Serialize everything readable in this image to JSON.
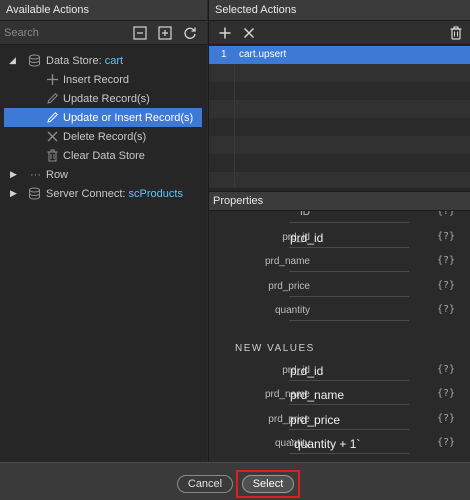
{
  "left_panel": {
    "title": "Available Actions",
    "search_placeholder": "Search",
    "tools": [
      "collapse-all-icon",
      "expand-all-icon",
      "refresh-icon"
    ],
    "tree": [
      {
        "prefix": "Data Store: ",
        "highlight": "cart",
        "icon": "database-icon",
        "expanded": true
      },
      {
        "label": "Insert Record",
        "icon": "plus-icon"
      },
      {
        "label": "Update Record(s)",
        "icon": "pencil-icon"
      },
      {
        "label": "Update or Insert Record(s)",
        "icon": "pencil-icon",
        "selected": true
      },
      {
        "label": "Delete Record(s)",
        "icon": "x-icon"
      },
      {
        "label": "Clear Data Store",
        "icon": "trash-icon"
      },
      {
        "label": "Row",
        "icon": "ellipsis-icon",
        "expanded": false
      },
      {
        "prefix": "Server Connect: ",
        "highlight": "scProducts",
        "icon": "database-icon",
        "expanded": false
      }
    ]
  },
  "right_panel": {
    "title": "Selected Actions",
    "tools": [
      "add-icon",
      "remove-icon",
      "trash-icon"
    ],
    "actions": [
      {
        "num": "1",
        "name": "cart.upsert"
      }
    ]
  },
  "properties": {
    "title": "Properties",
    "filter_rows": [
      {
        "label": "ID",
        "value": ""
      },
      {
        "label": "prd_id",
        "value": "prd_id"
      },
      {
        "label": "prd_name",
        "value": ""
      },
      {
        "label": "prd_price",
        "value": ""
      },
      {
        "label": "quantity",
        "value": ""
      }
    ],
    "section_title": "NEW VALUES",
    "value_rows": [
      {
        "label": "prd_id",
        "value": "prd_id"
      },
      {
        "label": "prd_name",
        "value": "prd_name"
      },
      {
        "label": "prd_price",
        "value": "prd_price"
      },
      {
        "label": "quantity",
        "value": "`quantity + 1`"
      }
    ],
    "fx_label": "{?}"
  },
  "footer": {
    "cancel_label": "Cancel",
    "select_label": "Select"
  },
  "colors": {
    "accent": "#3d7ad6",
    "highlight": "#5cc4ff",
    "outline": "#e01e1e"
  }
}
